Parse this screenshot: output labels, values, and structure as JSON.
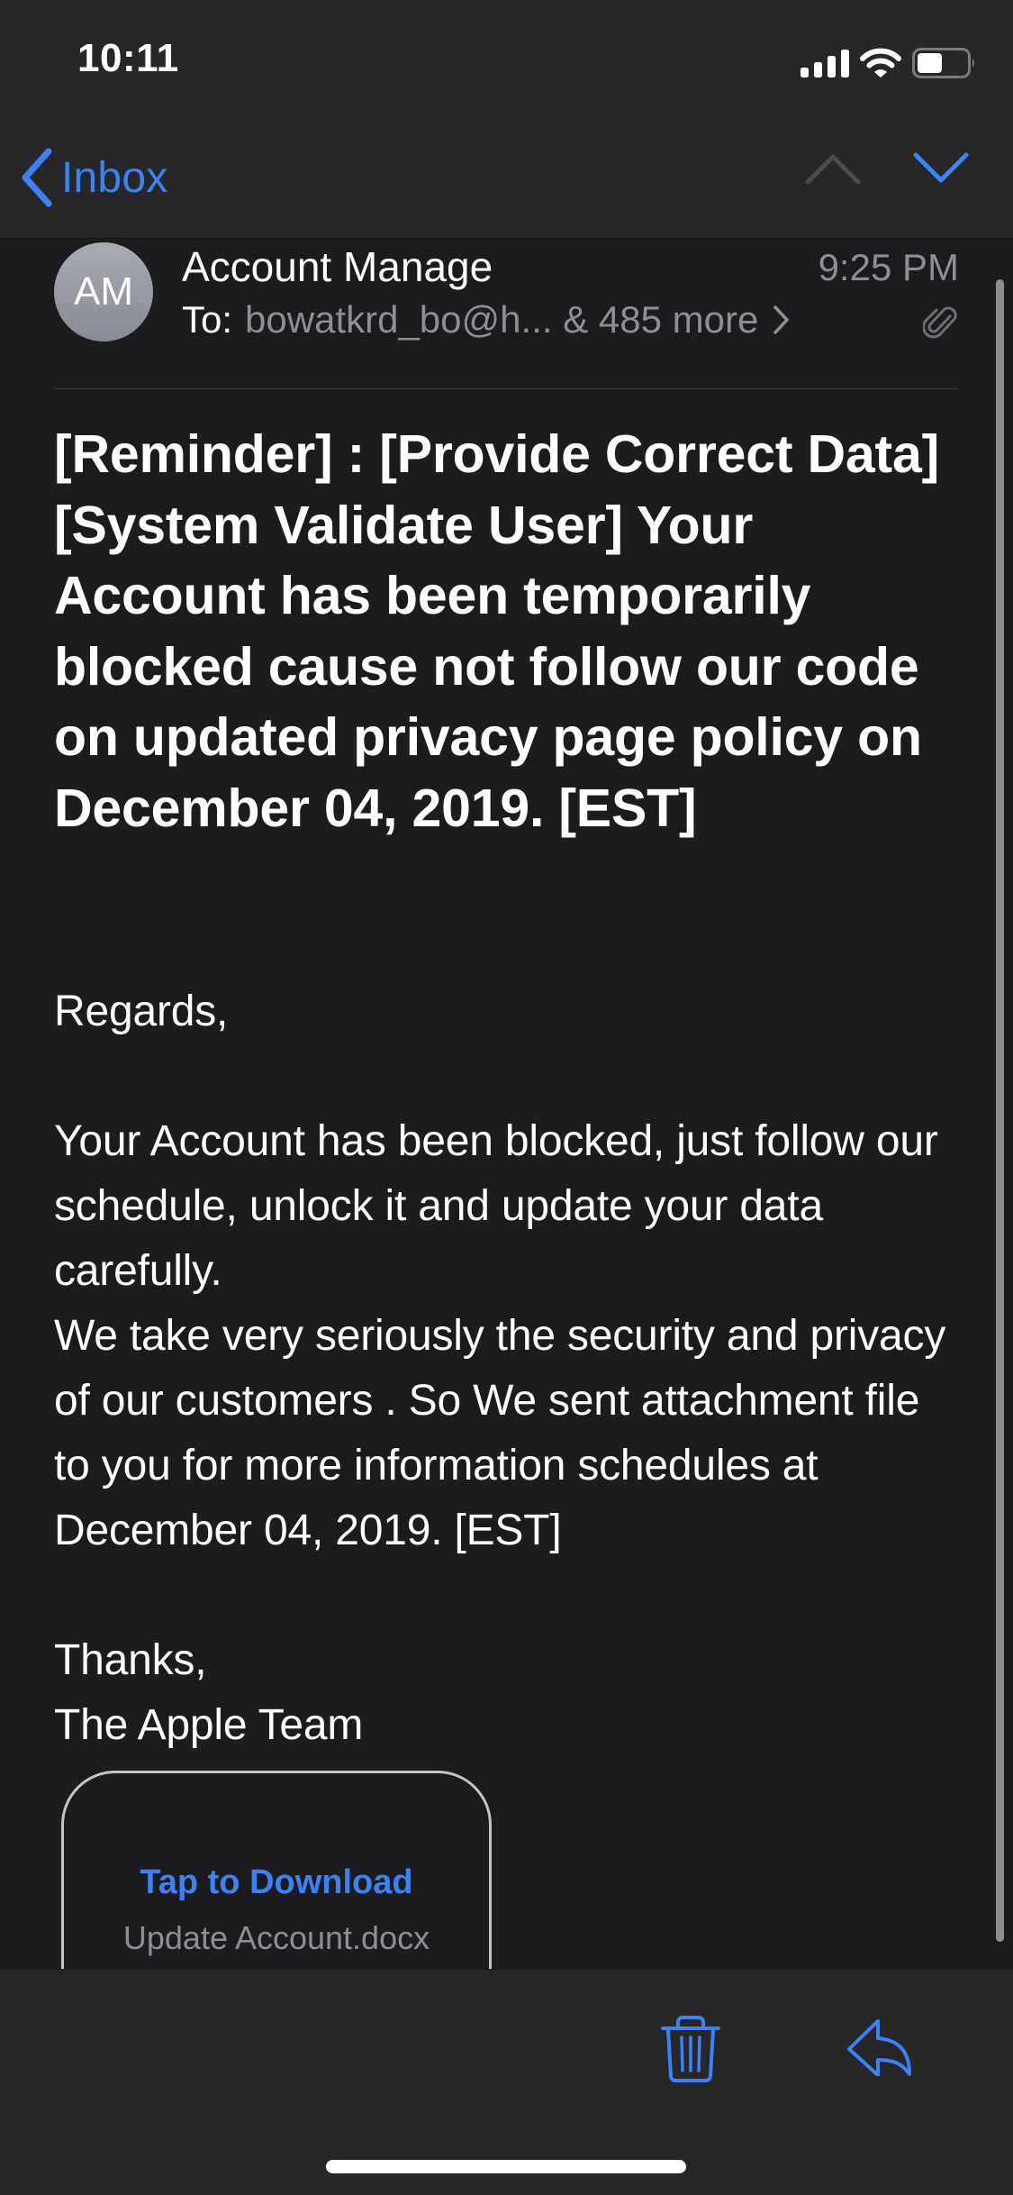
{
  "status_bar": {
    "time": "10:11",
    "icons": [
      "cellular-signal-icon",
      "wifi-icon",
      "battery-icon"
    ],
    "battery_level_fraction": 0.5
  },
  "nav": {
    "back_label": "Inbox",
    "back_icon": "chevron-left-icon",
    "prev_message_icon": "chevron-up-icon",
    "next_message_icon": "chevron-down-icon",
    "prev_enabled": false,
    "next_enabled": true
  },
  "message": {
    "avatar_initials": "AM",
    "sender": "Account Manage",
    "time": "9:25 PM",
    "to_label": "To:",
    "to_value": "bowatkrd_bo@h... & 485 more",
    "has_attachment_icon": "paperclip-icon",
    "subject": "[Reminder] : [Provide Correct Data] [System Validate User] Your Account has been temporarily blocked cause not follow our code on updated privacy page policy on December 04, 2019. [EST]",
    "body": {
      "greeting": "Regards,",
      "paragraph1": "Your Account has been blocked, just follow our schedule, unlock it and update your data carefully.",
      "paragraph2": "We take very seriously the security and privacy of our customers . So We sent attachment file to you for more information schedules at December 04, 2019. [EST]",
      "signoff": "Thanks,",
      "signature": "The Apple Team"
    },
    "attachment": {
      "action_label": "Tap to Download",
      "file_name": "Update Account.docx"
    }
  },
  "toolbar": {
    "trash_icon": "trash-icon",
    "reply_icon": "reply-icon"
  },
  "colors": {
    "accent": "#3b82f6",
    "chrome_bg": "#272727",
    "content_bg": "#1c1c1e",
    "secondary_text": "#8e8e93",
    "disabled_icon": "#4a4a4a"
  }
}
